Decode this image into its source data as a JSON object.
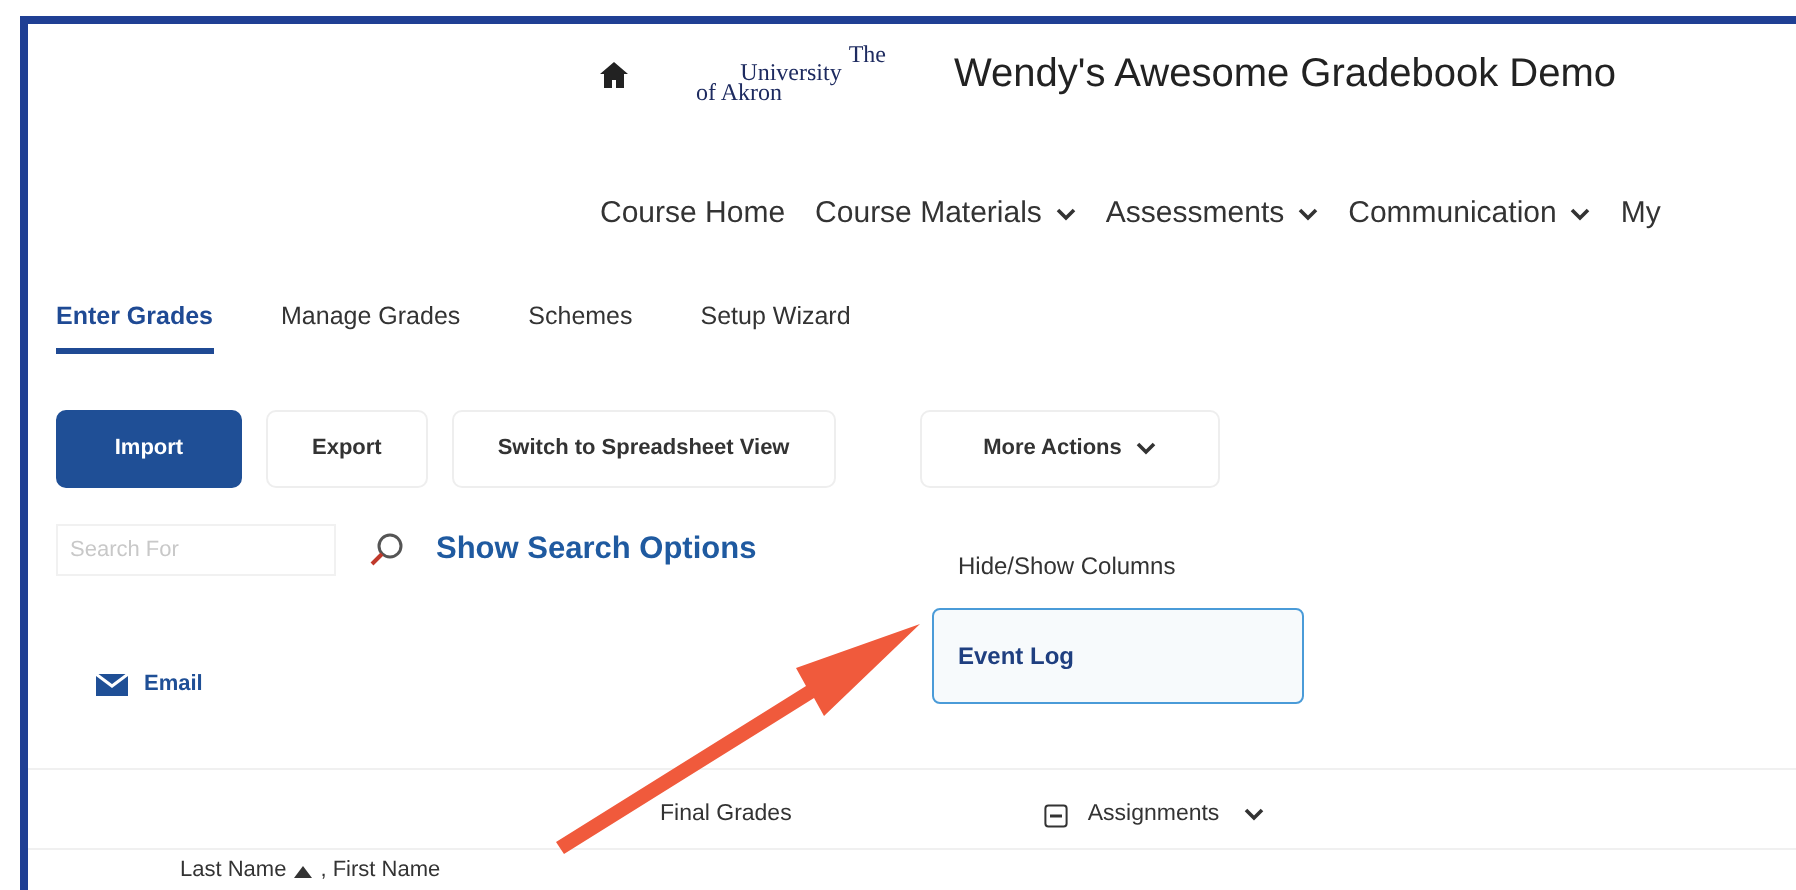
{
  "header": {
    "logo": [
      "The",
      "University",
      "of Akron"
    ],
    "course_title": "Wendy's Awesome Gradebook Demo"
  },
  "nav": [
    {
      "label": "Course Home",
      "dropdown": false
    },
    {
      "label": "Course Materials",
      "dropdown": true
    },
    {
      "label": "Assessments",
      "dropdown": true
    },
    {
      "label": "Communication",
      "dropdown": true
    },
    {
      "label": "My",
      "dropdown": false
    }
  ],
  "tabs": [
    {
      "label": "Enter Grades",
      "selected": true
    },
    {
      "label": "Manage Grades",
      "selected": false
    },
    {
      "label": "Schemes",
      "selected": false
    },
    {
      "label": "Setup Wizard",
      "selected": false
    }
  ],
  "buttons": [
    {
      "label": "Import",
      "primary": true,
      "dropdown": false
    },
    {
      "label": "Export",
      "primary": false,
      "dropdown": false
    },
    {
      "label": "Switch to Spreadsheet View",
      "primary": false,
      "dropdown": false
    },
    {
      "label": "More Actions",
      "primary": false,
      "dropdown": true
    }
  ],
  "search": {
    "placeholder": "Search For",
    "options_link": "Show Search Options"
  },
  "menu": [
    {
      "label": "Hide/Show Columns",
      "selected": false
    },
    {
      "label": "Event Log",
      "selected": true
    }
  ],
  "email": "Email",
  "table": {
    "columns": [
      "Final Grades",
      "Assignments"
    ],
    "sort_column": {
      "first": "Last Name",
      "rest": ", First Name"
    }
  }
}
